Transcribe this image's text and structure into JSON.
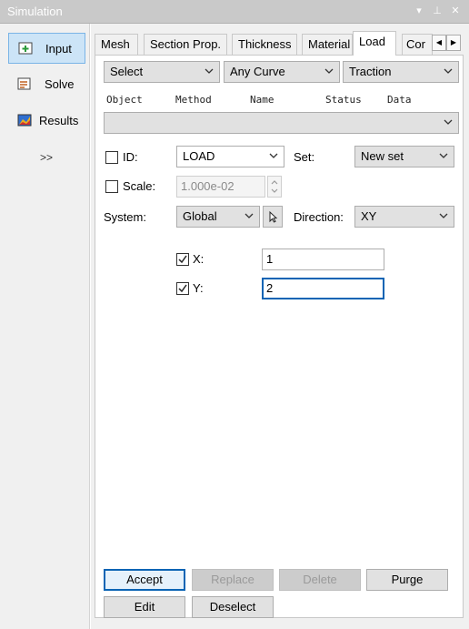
{
  "window": {
    "title": "Simulation"
  },
  "sidebar": {
    "items": [
      {
        "label": "Input",
        "icon": "input-icon"
      },
      {
        "label": "Solve",
        "icon": "solve-icon"
      },
      {
        "label": "Results",
        "icon": "results-icon"
      }
    ],
    "more_label": ">>"
  },
  "tabs": [
    {
      "label": "Mesh"
    },
    {
      "label": "Section Prop."
    },
    {
      "label": "Thickness"
    },
    {
      "label": "Material"
    },
    {
      "label": "Load"
    },
    {
      "label": "Cor"
    }
  ],
  "active_tab": "Load",
  "filters": {
    "select": "Select",
    "curve": "Any Curve",
    "load_type": "Traction"
  },
  "columns": [
    "Object",
    "Method",
    "Name",
    "Status",
    "Data"
  ],
  "object_combo": {
    "value": ""
  },
  "form": {
    "id_label": "ID:",
    "id_value": "LOAD",
    "set_label": "Set:",
    "set_value": "New set",
    "scale_label": "Scale:",
    "scale_value": "1.000e-02",
    "system_label": "System:",
    "system_value": "Global",
    "direction_label": "Direction:",
    "direction_value": "XY",
    "x_label": "X:",
    "x_value": "1",
    "y_label": "Y:",
    "y_value": "2"
  },
  "buttons": {
    "accept": "Accept",
    "replace": "Replace",
    "delete": "Delete",
    "purge": "Purge",
    "edit": "Edit",
    "deselect": "Deselect"
  }
}
